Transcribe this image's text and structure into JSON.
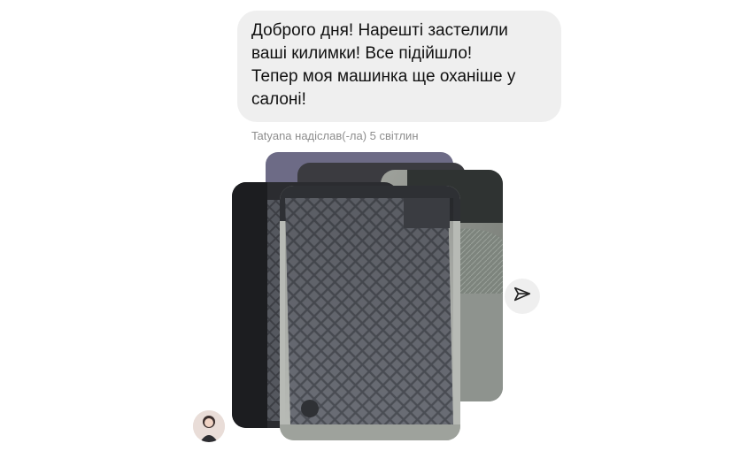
{
  "message": {
    "text": "Доброго дня! Нарешті застелили\nваші килимки! Все підійшло!\nТепер моя машинка ще оханіше у\nсалоні!"
  },
  "caption": "Tatyana надіслав(-ла) 5 світлин",
  "icons": {
    "share": "paper-plane-icon",
    "avatar": "user-avatar"
  },
  "colors": {
    "bubble": "#efefef",
    "caption": "#8e8e8e",
    "text": "#111111"
  }
}
